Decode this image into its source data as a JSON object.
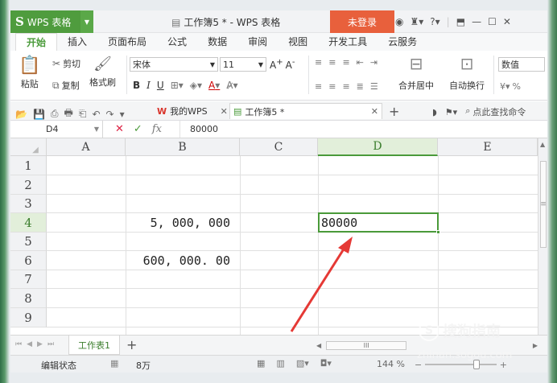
{
  "titlebar": {
    "app_name": "WPS 表格",
    "logo_letter": "S",
    "doc_title": "工作簿5 * - WPS 表格",
    "login": "未登录",
    "help": "?"
  },
  "menu": [
    "开始",
    "插入",
    "页面布局",
    "公式",
    "数据",
    "审阅",
    "视图",
    "开发工具",
    "云服务"
  ],
  "ribbon": {
    "cut": "剪切",
    "copy": "复制",
    "format_painter": "格式刷",
    "paste": "粘贴",
    "font": "宋体",
    "font_size": "11",
    "bold": "B",
    "italic": "I",
    "underline": "U",
    "merge_center": "合并居中",
    "wrap_text": "自动换行",
    "number_format": "数值",
    "percent": "%"
  },
  "quickbar": {
    "mywps": "我的WPS",
    "doc_tab": "工作簿5 *",
    "search": "点此查找命令"
  },
  "formulabar": {
    "cell_ref": "D4",
    "fx": "fx",
    "value": "80000"
  },
  "sheet": {
    "columns": [
      "A",
      "B",
      "C",
      "D",
      "E"
    ],
    "active_column": "D",
    "rows": [
      "1",
      "2",
      "3",
      "4",
      "5",
      "6",
      "7",
      "8",
      "9"
    ],
    "active_row": "4",
    "cells": {
      "B4": "5, 000, 000",
      "D4": "80000",
      "B6": "600, 000. 00"
    }
  },
  "sheettabs": {
    "tab1": "工作表1",
    "add": "+",
    "scroll_label": "III"
  },
  "status": {
    "mode": "编辑状态",
    "count": "8万",
    "zoom": "144 %"
  },
  "watermark": {
    "brand": "搜狗指南",
    "url": "zhinan.sogou.com"
  },
  "colors": {
    "accent": "#4a9a3a",
    "login": "#e8603c",
    "arrow": "#e53935"
  }
}
